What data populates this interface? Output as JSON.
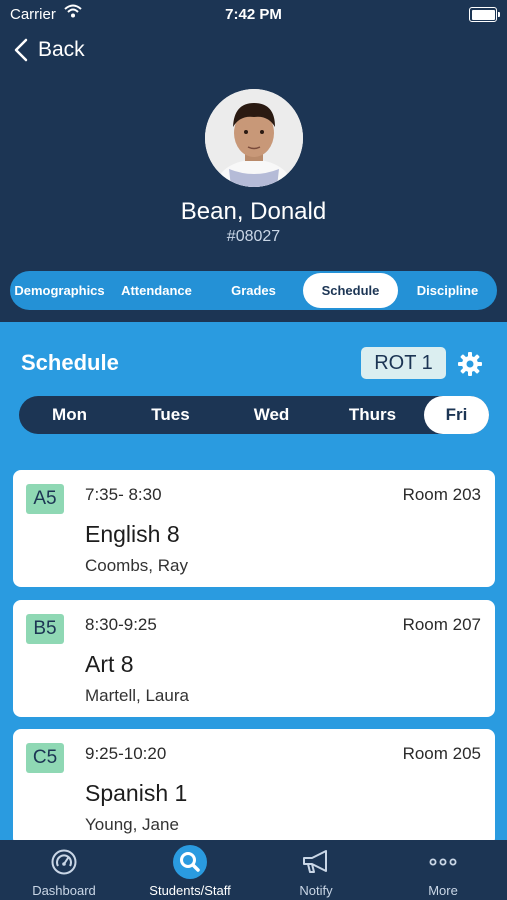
{
  "status_bar": {
    "carrier": "Carrier",
    "time": "7:42 PM"
  },
  "header": {
    "back_label": "Back"
  },
  "student": {
    "name": "Bean, Donald",
    "id": "#08027"
  },
  "tabs": [
    {
      "label": "Demographics"
    },
    {
      "label": "Attendance"
    },
    {
      "label": "Grades"
    },
    {
      "label": "Schedule",
      "active": true
    },
    {
      "label": "Discipline"
    }
  ],
  "schedule": {
    "title": "Schedule",
    "rotation": "ROT 1",
    "days": [
      "Mon",
      "Tues",
      "Wed",
      "Thurs",
      "Fri"
    ],
    "selected_day": "Fri",
    "classes": [
      {
        "block": "A5",
        "time": "7:35- 8:30",
        "room": "Room 203",
        "course": "English 8",
        "teacher": "Coombs, Ray"
      },
      {
        "block": "B5",
        "time": "8:30-9:25",
        "room": "Room 207",
        "course": "Art 8",
        "teacher": "Martell, Laura"
      },
      {
        "block": "C5",
        "time": "9:25-10:20",
        "room": "Room 205",
        "course": "Spanish 1",
        "teacher": "Young, Jane"
      }
    ]
  },
  "bottom_nav": [
    {
      "label": "Dashboard",
      "icon": "dashboard-icon"
    },
    {
      "label": "Students/Staff",
      "icon": "search-icon",
      "active": true
    },
    {
      "label": "Notify",
      "icon": "megaphone-icon"
    },
    {
      "label": "More",
      "icon": "more-icon"
    }
  ],
  "colors": {
    "navy": "#1c3554",
    "blue": "#2a9be0",
    "block_green": "#8fd8b4"
  }
}
